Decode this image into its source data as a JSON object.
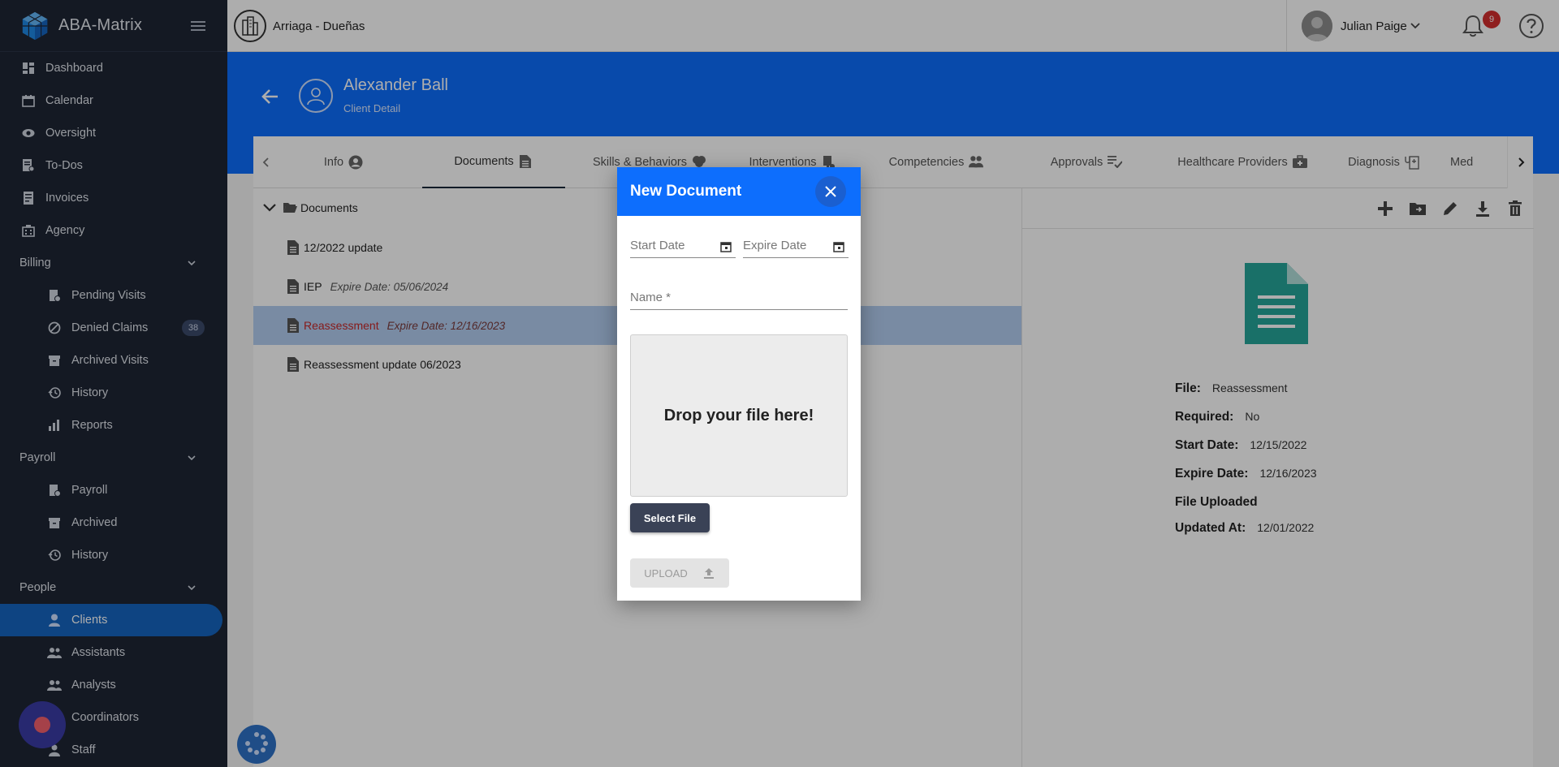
{
  "app": {
    "name": "ABA-Matrix"
  },
  "sidebar": {
    "items": [
      {
        "label": "Dashboard",
        "icon": "dashboard-icon"
      },
      {
        "label": "Calendar",
        "icon": "calendar-icon"
      },
      {
        "label": "Oversight",
        "icon": "eye-icon"
      },
      {
        "label": "To-Dos",
        "icon": "todo-icon"
      },
      {
        "label": "Invoices",
        "icon": "invoice-icon"
      },
      {
        "label": "Agency",
        "icon": "agency-icon"
      }
    ],
    "billing": {
      "label": "Billing",
      "items": [
        {
          "label": "Pending Visits"
        },
        {
          "label": "Denied Claims",
          "badge": "38"
        },
        {
          "label": "Archived Visits"
        },
        {
          "label": "History"
        },
        {
          "label": "Reports"
        }
      ]
    },
    "payroll": {
      "label": "Payroll",
      "items": [
        {
          "label": "Payroll"
        },
        {
          "label": "Archived"
        },
        {
          "label": "History"
        }
      ]
    },
    "people": {
      "label": "People",
      "items": [
        {
          "label": "Clients"
        },
        {
          "label": "Assistants"
        },
        {
          "label": "Analysts"
        },
        {
          "label": "Coordinators"
        },
        {
          "label": "Staff"
        }
      ]
    }
  },
  "topbar": {
    "org_name": "Arriaga - Dueñas",
    "user_name": "Julian Paige",
    "notifications": "9"
  },
  "client": {
    "name": "Alexander Ball",
    "subtitle": "Client Detail"
  },
  "tabs": [
    {
      "label": "Info"
    },
    {
      "label": "Documents"
    },
    {
      "label": "Skills & Behaviors"
    },
    {
      "label": "Interventions"
    },
    {
      "label": "Competencies"
    },
    {
      "label": "Approvals"
    },
    {
      "label": "Healthcare Providers"
    },
    {
      "label": "Diagnosis"
    },
    {
      "label": "Med"
    }
  ],
  "documents": {
    "folder": "Documents",
    "rows": [
      {
        "title": "12/2022 update",
        "expire": ""
      },
      {
        "title": "IEP",
        "expire": "Expire Date: 05/06/2024"
      },
      {
        "title": "Reassessment",
        "expire": "Expire Date: 12/16/2023"
      },
      {
        "title": "Reassessment update 06/2023",
        "expire": ""
      }
    ]
  },
  "detail": {
    "file_label": "File:",
    "file_value": "Reassessment",
    "required_label": "Required:",
    "required_value": "No",
    "start_label": "Start Date:",
    "start_value": "12/15/2022",
    "expire_label": "Expire Date:",
    "expire_value": "12/16/2023",
    "uploaded_label": "File Uploaded",
    "updated_label": "Updated At:",
    "updated_value": "12/01/2022"
  },
  "modal": {
    "title": "New Document",
    "start_placeholder": "Start Date",
    "expire_placeholder": "Expire Date",
    "name_placeholder": "Name *",
    "drop_text": "Drop your file here!",
    "select_file": "Select File",
    "upload": "UPLOAD"
  },
  "colors": {
    "sidebar_bg": "#1e2534",
    "accent": "#0d6efd",
    "active_nav": "#1565c0",
    "badge_red": "#d32f2f",
    "file_icon": "#26a69a"
  }
}
